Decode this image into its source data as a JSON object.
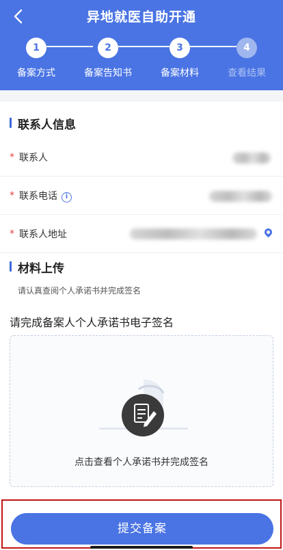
{
  "header": {
    "title": "异地就医自助开通",
    "back_icon": "chevron-left-icon"
  },
  "steps": [
    {
      "number": "1",
      "label": "备案方式",
      "active": true
    },
    {
      "number": "2",
      "label": "备案告知书",
      "active": true
    },
    {
      "number": "3",
      "label": "备案材料",
      "active": true
    },
    {
      "number": "4",
      "label": "查看结果",
      "active": false
    }
  ],
  "contact_section": {
    "title": "联系人信息",
    "fields": [
      {
        "label": "联系人",
        "required": true
      },
      {
        "label": "联系电话",
        "required": true,
        "has_info_icon": true
      },
      {
        "label": "联系人地址",
        "required": true,
        "has_location_icon": true
      }
    ]
  },
  "upload_section": {
    "title": "材料上传",
    "hint": "请认真查阅个人承诺书并完成签名",
    "sign_title": "请完成备案人个人承诺书电子签名",
    "box_caption": "点击查看个人承诺书并完成签名"
  },
  "submit": {
    "label": "提交备案"
  },
  "colors": {
    "primary": "#4a74e4",
    "required": "#e64040",
    "highlight_border": "#c01414"
  }
}
